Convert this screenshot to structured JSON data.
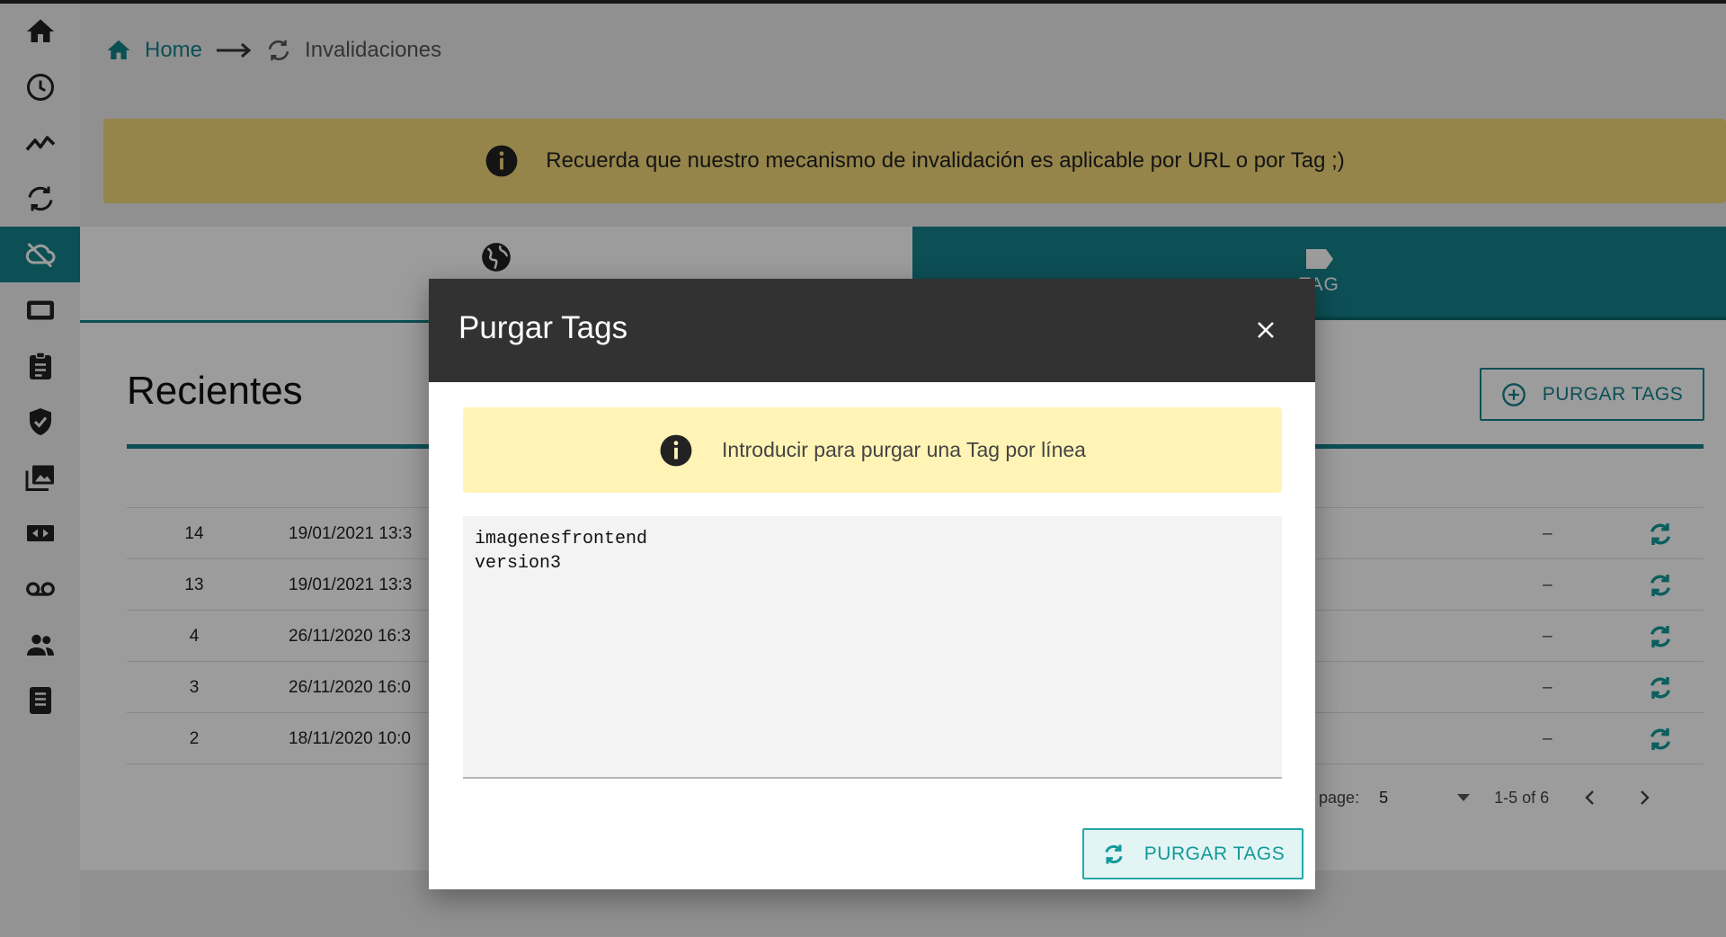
{
  "breadcrumb": {
    "home": "Home",
    "current": "Invalidaciones"
  },
  "banner": {
    "text": "Recuerda que nuestro mecanismo de invalidación es aplicable por URL o por Tag ;)"
  },
  "tabs": {
    "tag_label": "TAG"
  },
  "section": {
    "title": "Recientes",
    "purge_button": "PURGAR TAGS"
  },
  "table": {
    "rows": [
      {
        "id": "14",
        "date": "19/01/2021 13:3",
        "value": "–"
      },
      {
        "id": "13",
        "date": "19/01/2021 13:3",
        "value": "–"
      },
      {
        "id": "4",
        "date": "26/11/2020 16:3",
        "value": "–"
      },
      {
        "id": "3",
        "date": "26/11/2020 16:0",
        "value": "–"
      },
      {
        "id": "2",
        "date": "18/11/2020 10:0",
        "value": "–"
      }
    ]
  },
  "pagination": {
    "rows_label": "ows per page:",
    "rows_value": "5",
    "range": "1-5 of 6"
  },
  "modal": {
    "title": "Purgar Tags",
    "info": "Introducir para purgar una Tag por línea",
    "textarea_value": "imagenesfrontend\nversion3",
    "submit_label": "PURGAR TAGS"
  },
  "colors": {
    "accent": "#15828b",
    "banner": "#f3d97a",
    "modal_header": "#323232",
    "info_bg": "#fff4b5"
  }
}
